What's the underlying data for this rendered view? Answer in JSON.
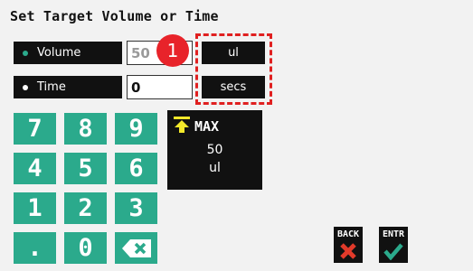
{
  "title": "Set Target Volume or Time",
  "modes": {
    "volume": {
      "label": "Volume",
      "value": "50",
      "unit": "ul",
      "selected": true
    },
    "time": {
      "label": "Time",
      "value": "0",
      "unit": "secs",
      "selected": false
    }
  },
  "badge": "1",
  "keypad": {
    "keys": [
      "7",
      "8",
      "9",
      "4",
      "5",
      "6",
      "1",
      "2",
      "3",
      ".",
      "0",
      "backspace"
    ]
  },
  "max_panel": {
    "label": "MAX",
    "value": "50",
    "unit": "ul"
  },
  "buttons": {
    "back": "BACK",
    "enter": "ENTR"
  },
  "colors": {
    "accent_teal": "#2baa8c",
    "highlight_red": "#e02020",
    "max_arrow_yellow": "#f3e82a",
    "back_red": "#e23a2a",
    "enter_green": "#2baa8c"
  }
}
